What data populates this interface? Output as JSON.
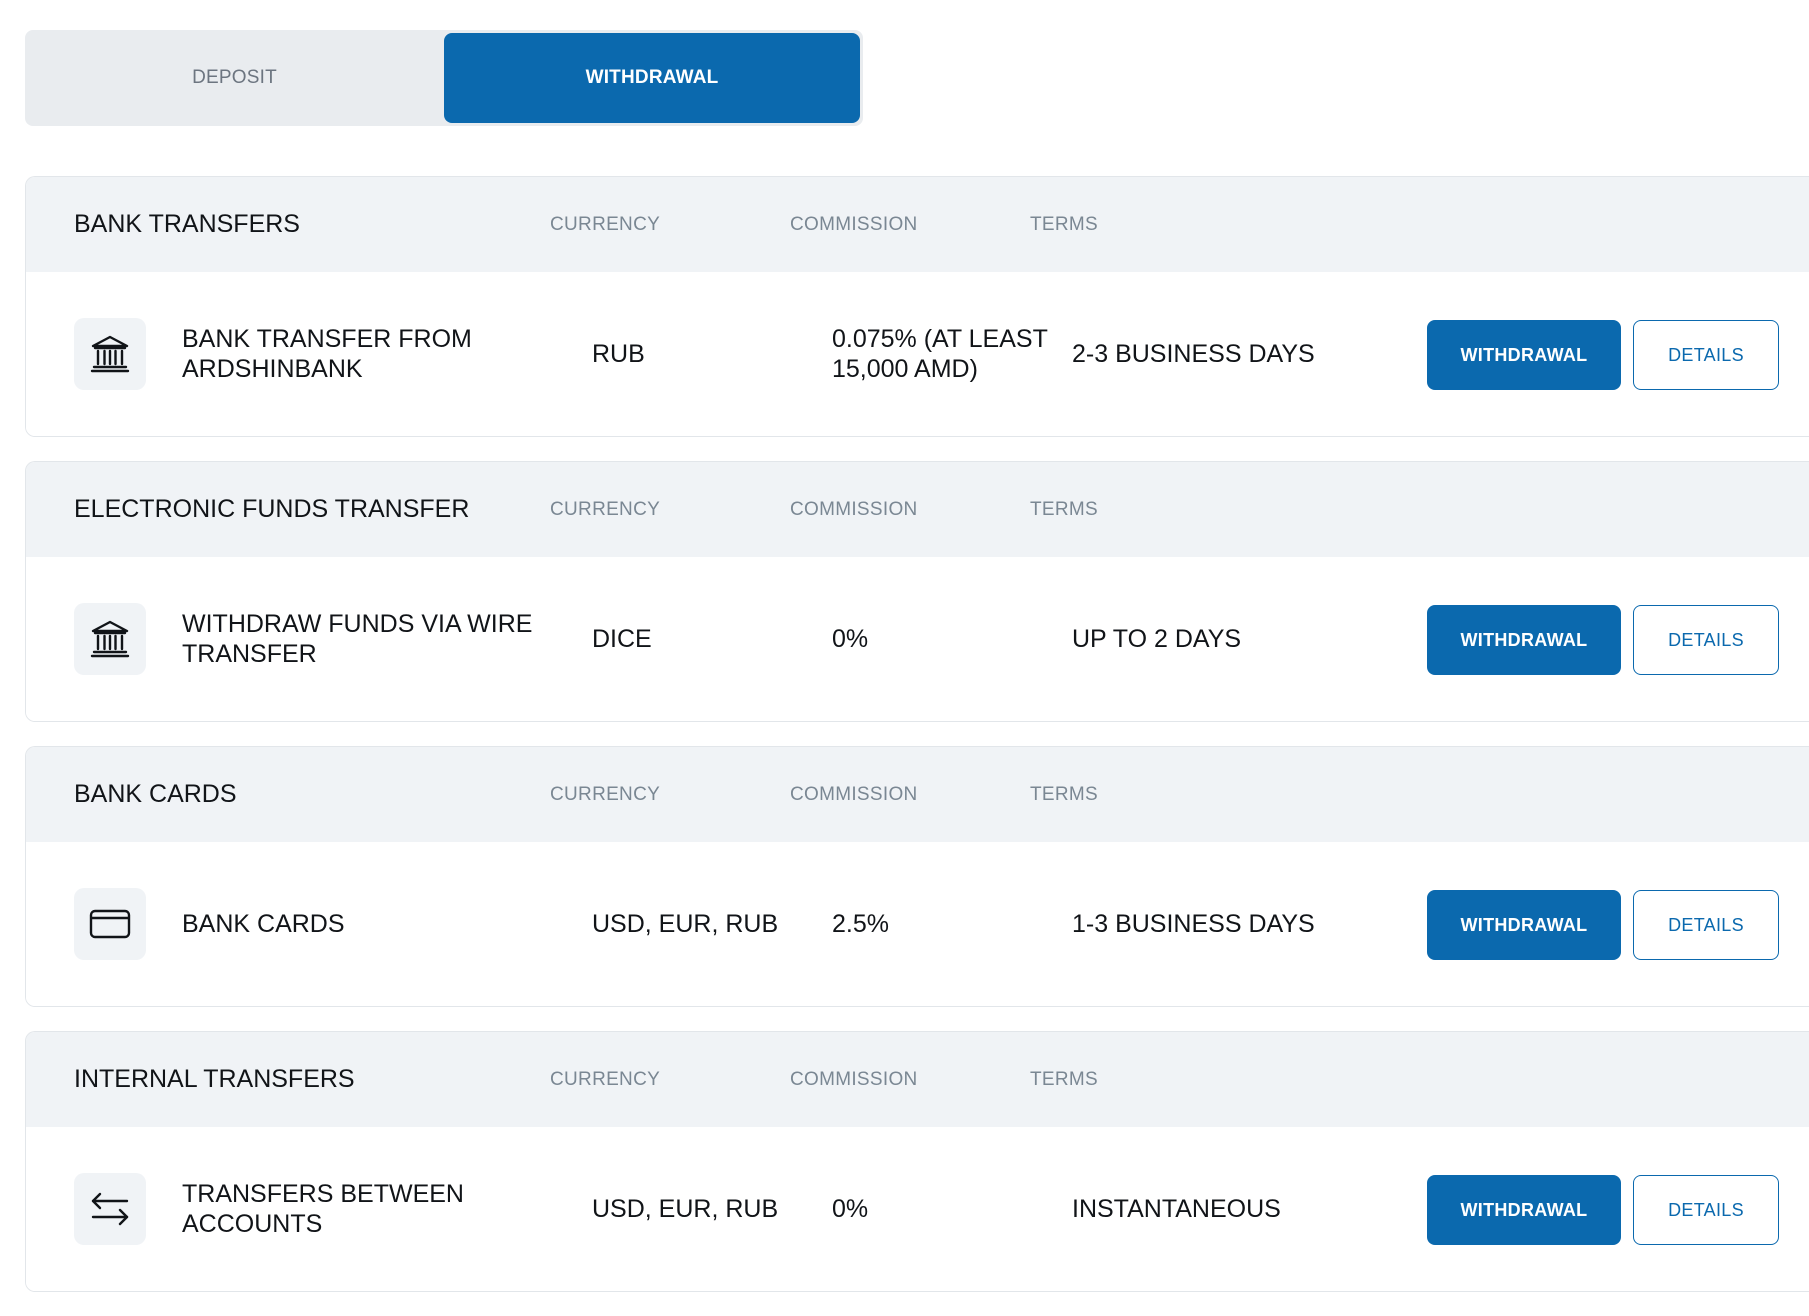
{
  "tabs": [
    {
      "label": "DEPOSIT",
      "active": false
    },
    {
      "label": "WITHDRAWAL",
      "active": true
    }
  ],
  "colors": {
    "accent": "#0b69ae",
    "header_bg": "#f0f3f6",
    "tab_bg": "#e9ecef"
  },
  "sections": [
    {
      "title": "BANK TRANSFERS",
      "col_currency": "CURRENCY",
      "col_commission": "COMMISSION",
      "col_terms": "TERMS",
      "row": {
        "icon": "bank-icon",
        "name": "BANK TRANSFER FROM ARDSHINBANK",
        "currency": "RUB",
        "commission": "0.075% (AT LEAST 15,000 AMD)",
        "terms": "2-3 BUSINESS DAYS",
        "withdraw_label": "WITHDRAWAL",
        "details_label": "DETAILS"
      }
    },
    {
      "title": "ELECTRONIC FUNDS TRANSFER",
      "col_currency": "CURRENCY",
      "col_commission": "COMMISSION",
      "col_terms": "TERMS",
      "row": {
        "icon": "bank-icon",
        "name": "WITHDRAW FUNDS VIA WIRE TRANSFER",
        "currency": "DICE",
        "commission": "0%",
        "terms": "UP TO 2 DAYS",
        "withdraw_label": "WITHDRAWAL",
        "details_label": "DETAILS"
      }
    },
    {
      "title": "BANK CARDS",
      "col_currency": "CURRENCY",
      "col_commission": "COMMISSION",
      "col_terms": "TERMS",
      "row": {
        "icon": "credit-card-icon",
        "name": "BANK CARDS",
        "currency": "USD, EUR, RUB",
        "commission": "2.5%",
        "terms": "1-3 BUSINESS DAYS",
        "withdraw_label": "WITHDRAWAL",
        "details_label": "DETAILS"
      }
    },
    {
      "title": "INTERNAL TRANSFERS",
      "col_currency": "CURRENCY",
      "col_commission": "COMMISSION",
      "col_terms": "TERMS",
      "row": {
        "icon": "transfer-arrows-icon",
        "name": "TRANSFERS BETWEEN ACCOUNTS",
        "currency": "USD, EUR, RUB",
        "commission": "0%",
        "terms": "INSTANTANEOUS",
        "withdraw_label": "WITHDRAWAL",
        "details_label": "DETAILS"
      }
    }
  ]
}
